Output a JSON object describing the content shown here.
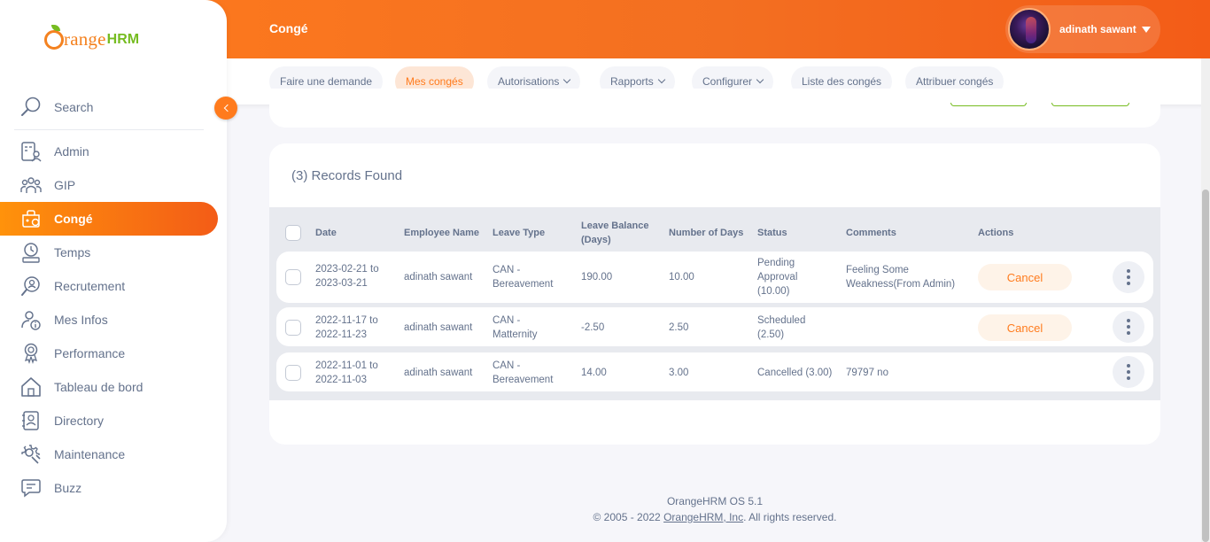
{
  "header": {
    "title": "Congé",
    "user_name": "adinath sawant"
  },
  "subnav": {
    "tabs": [
      {
        "label": "Faire une demande",
        "active": false,
        "dropdown": false
      },
      {
        "label": "Mes congés",
        "active": true,
        "dropdown": false
      },
      {
        "label": "Autorisations",
        "active": false,
        "dropdown": true
      },
      {
        "label": "Rapports",
        "active": false,
        "dropdown": true
      },
      {
        "label": "Configurer",
        "active": false,
        "dropdown": true
      },
      {
        "label": "Liste des congés",
        "active": false,
        "dropdown": false
      },
      {
        "label": "Attribuer congés",
        "active": false,
        "dropdown": false
      }
    ]
  },
  "sidebar": {
    "logo": {
      "part1": "range",
      "part2": "HRM"
    },
    "search_label": "Search",
    "items": [
      {
        "label": "Admin",
        "icon": "admin-icon",
        "active": false
      },
      {
        "label": "GIP",
        "icon": "people-icon",
        "active": false
      },
      {
        "label": "Congé",
        "icon": "leave-icon",
        "active": true
      },
      {
        "label": "Temps",
        "icon": "time-icon",
        "active": false
      },
      {
        "label": "Recrutement",
        "icon": "recruitment-icon",
        "active": false
      },
      {
        "label": "Mes Infos",
        "icon": "my-info-icon",
        "active": false
      },
      {
        "label": "Performance",
        "icon": "performance-icon",
        "active": false
      },
      {
        "label": "Tableau de bord",
        "icon": "dashboard-icon",
        "active": false
      },
      {
        "label": "Directory",
        "icon": "directory-icon",
        "active": false
      },
      {
        "label": "Maintenance",
        "icon": "maintenance-icon",
        "active": false
      },
      {
        "label": "Buzz",
        "icon": "buzz-icon",
        "active": false
      }
    ]
  },
  "records": {
    "count_text": "(3) Records Found",
    "columns": [
      "Date",
      "Employee Name",
      "Leave Type",
      "Leave Balance (Days)",
      "Number of Days",
      "Status",
      "Comments",
      "Actions"
    ],
    "rows": [
      {
        "date": "2023-02-21 to 2023-03-21",
        "employee": "adinath sawant",
        "leave_type": "CAN - Bereavement",
        "balance": "190.00",
        "days": "10.00",
        "status": "Pending Approval (10.00)",
        "comments": "Feeling Some Weakness(From Admin)",
        "action": "Cancel"
      },
      {
        "date": "2022-11-17 to 2022-11-23",
        "employee": "adinath sawant",
        "leave_type": "CAN - Matternity",
        "balance": "-2.50",
        "days": "2.50",
        "status": "Scheduled (2.50)",
        "comments": "",
        "action": "Cancel"
      },
      {
        "date": "2022-11-01 to 2022-11-03",
        "employee": "adinath sawant",
        "leave_type": "CAN - Bereavement",
        "balance": "14.00",
        "days": "3.00",
        "status": "Cancelled (3.00)",
        "comments": "79797 no",
        "action": ""
      }
    ]
  },
  "footer": {
    "version": "OrangeHRM OS 5.1",
    "copyright_prefix": "© 2005 - 2022 ",
    "company_link": "OrangeHRM, Inc",
    "copyright_suffix": ". All rights reserved."
  },
  "colors": {
    "accent": "#ff7b1d",
    "brand_green": "#76bc21",
    "text": "#64728c"
  }
}
